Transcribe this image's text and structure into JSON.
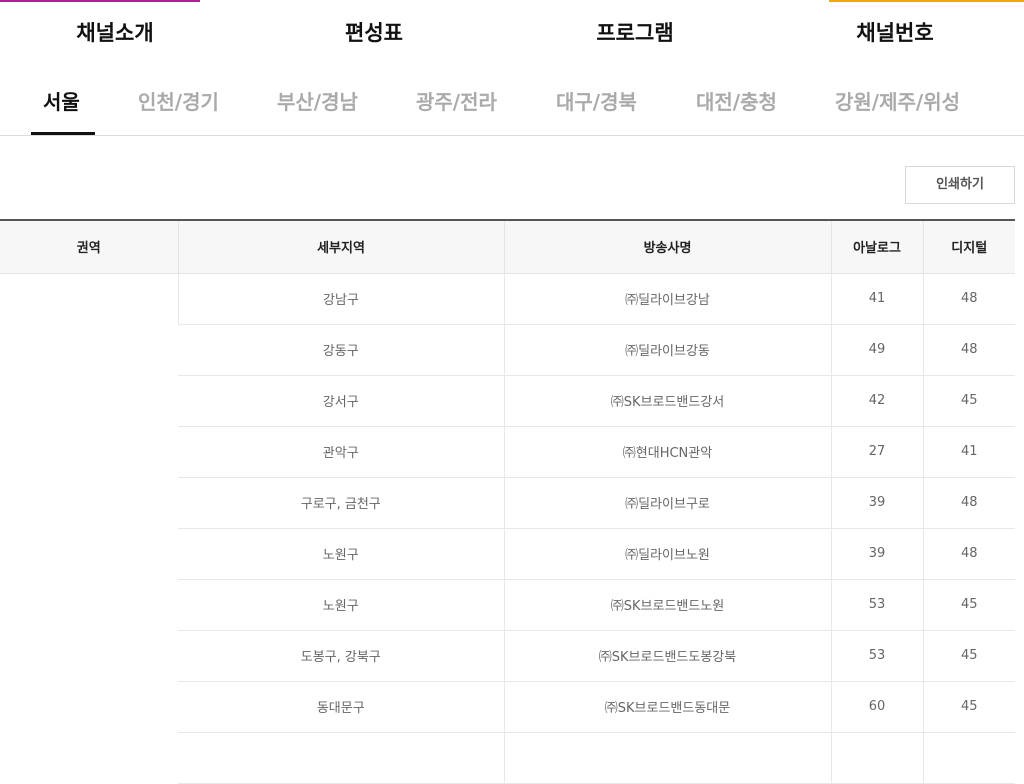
{
  "top_nav": {
    "items": [
      "채널소개",
      "편성표",
      "프로그램",
      "채널번호"
    ],
    "accent_colors": [
      "#b5208f",
      "#f0a70f"
    ]
  },
  "region_tabs": {
    "items": [
      "서울",
      "인천/경기",
      "부산/경남",
      "광주/전라",
      "대구/경북",
      "대전/충청",
      "강원/제주/위성"
    ],
    "active": "서울"
  },
  "print_button": {
    "label": "인쇄하기"
  },
  "table": {
    "headers": [
      "권역",
      "세부지역",
      "방송사명",
      "아날로그",
      "디지털"
    ],
    "area": "",
    "rows": [
      {
        "district": "강남구",
        "broadcaster": "㈜딜라이브강남",
        "analog": "41",
        "digital": "48"
      },
      {
        "district": "강동구",
        "broadcaster": "㈜딜라이브강동",
        "analog": "49",
        "digital": "48"
      },
      {
        "district": "강서구",
        "broadcaster": "㈜SK브로드밴드강서",
        "analog": "42",
        "digital": "45"
      },
      {
        "district": "관악구",
        "broadcaster": "㈜현대HCN관악",
        "analog": "27",
        "digital": "41"
      },
      {
        "district": "구로구, 금천구",
        "broadcaster": "㈜딜라이브구로",
        "analog": "39",
        "digital": "48"
      },
      {
        "district": "노원구",
        "broadcaster": "㈜딜라이브노원",
        "analog": "39",
        "digital": "48"
      },
      {
        "district": "노원구",
        "broadcaster": "㈜SK브로드밴드노원",
        "analog": "53",
        "digital": "45"
      },
      {
        "district": "도봉구, 강북구",
        "broadcaster": "㈜SK브로드밴드도봉강북",
        "analog": "53",
        "digital": "45"
      },
      {
        "district": "동대문구",
        "broadcaster": "㈜SK브로드밴드동대문",
        "analog": "60",
        "digital": "45"
      }
    ]
  }
}
